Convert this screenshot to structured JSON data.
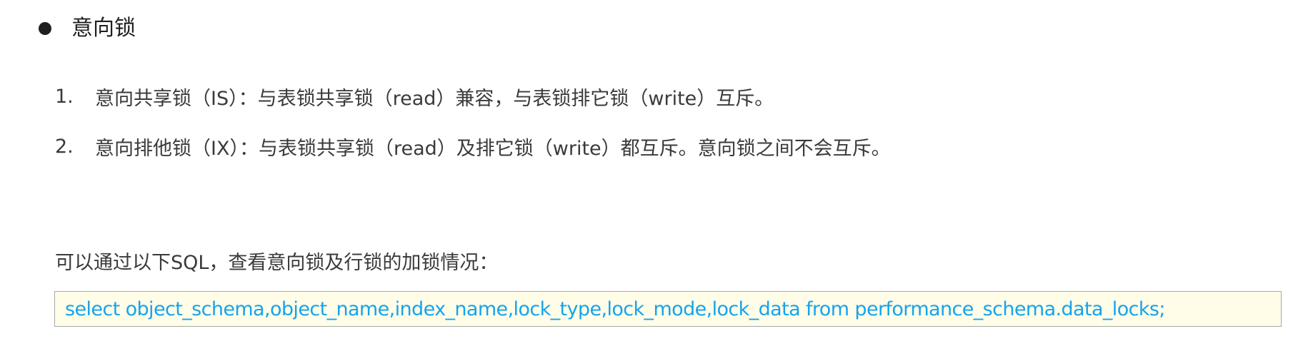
{
  "heading": {
    "title": "意向锁"
  },
  "list": [
    {
      "number": "1.",
      "text": "意向共享锁（IS）：与表锁共享锁（read）兼容，与表锁排它锁（write）互斥。"
    },
    {
      "number": "2.",
      "text": "意向排他锁（IX）：与表锁共享锁（read）及排它锁（write）都互斥。意向锁之间不会互斥。"
    }
  ],
  "paragraph": {
    "text": "可以通过以下SQL，查看意向锁及行锁的加锁情况："
  },
  "code": {
    "text": "select object_schema,object_name,index_name,lock_type,lock_mode,lock_data from performance_schema.data_locks;"
  },
  "colors": {
    "code_text": "#16a3ee",
    "code_background": "#fffde8",
    "code_border": "#a9a9a9"
  }
}
